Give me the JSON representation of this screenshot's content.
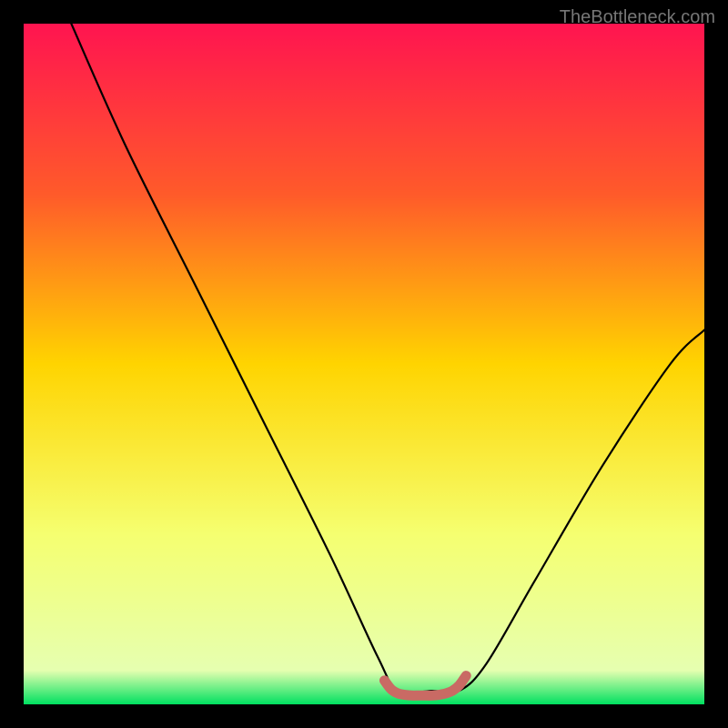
{
  "watermark": "TheBottleneck.com",
  "chart_data": {
    "type": "line",
    "title": "",
    "xlabel": "",
    "ylabel": "",
    "xlim": [
      0,
      100
    ],
    "ylim": [
      0,
      100
    ],
    "gradient_stops": [
      {
        "pos": 0,
        "color": "#ff1450"
      },
      {
        "pos": 25,
        "color": "#ff5a2a"
      },
      {
        "pos": 50,
        "color": "#ffd400"
      },
      {
        "pos": 75,
        "color": "#f5ff70"
      },
      {
        "pos": 95,
        "color": "#e6ffb0"
      },
      {
        "pos": 100,
        "color": "#00e060"
      }
    ],
    "series": [
      {
        "name": "curve",
        "color": "#000000",
        "x": [
          7,
          15,
          25,
          35,
          45,
          52,
          55,
          60,
          64,
          68,
          75,
          85,
          95,
          100
        ],
        "y": [
          100,
          82,
          62,
          42,
          22,
          7,
          2,
          2,
          2,
          6,
          18,
          35,
          50,
          55
        ]
      },
      {
        "name": "valley-marker",
        "color": "#c96a64",
        "x": [
          53,
          54,
          55,
          56,
          57,
          58,
          59,
          60,
          61,
          62,
          63,
          64,
          65
        ],
        "y": [
          3.5,
          2.2,
          1.6,
          1.4,
          1.3,
          1.3,
          1.3,
          1.3,
          1.4,
          1.6,
          2.0,
          2.8,
          4.2
        ]
      }
    ]
  }
}
